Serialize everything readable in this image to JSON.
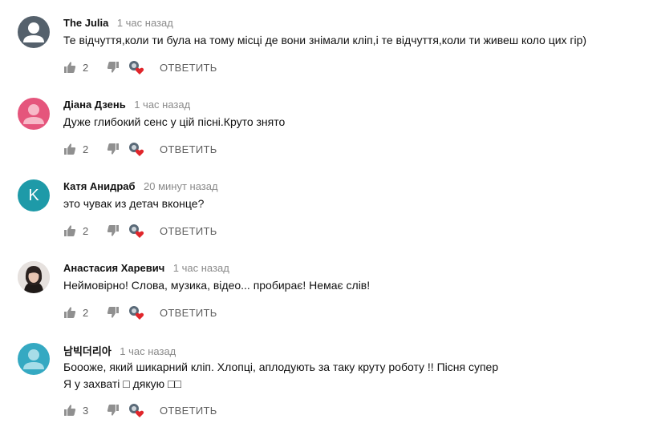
{
  "comments": [
    {
      "author": "The Julia",
      "time": "1 час назад",
      "text": [
        "Те відчуття,коли ти була на тому місці де  вони знімали кліп,і те відчуття,коли ти живеш коло цих гір)"
      ],
      "likes": "2",
      "reply": "ОТВЕТИТЬ",
      "avatar_color": "#55616c"
    },
    {
      "author": "Діана Дзень",
      "time": "1 час назад",
      "text": [
        "Дуже глибокий сенс у цій пісні.Круто знято"
      ],
      "likes": "2",
      "reply": "ОТВЕТИТЬ",
      "avatar_color": "#e5557c"
    },
    {
      "author": "Катя Анидраб",
      "time": "20 минут назад",
      "text": [
        "это чувак из детач вконце?"
      ],
      "likes": "2",
      "reply": "ОТВЕТИТЬ",
      "avatar_letter": "K",
      "avatar_color": "#1e9aa8"
    },
    {
      "author": "Анастасия Харевич",
      "time": "1 час назад",
      "text": [
        "Неймовірно! Слова, музика, відео... пробирає! Немає слів!"
      ],
      "likes": "2",
      "reply": "ОТВЕТИТЬ",
      "avatar_color": "#d8d2cf"
    },
    {
      "author": "남빅더리아",
      "time": "1 час назад",
      "text": [
        "Боооже, який шикарний кліп. Хлопці, аплодують за таку круту роботу !! Пісня супер",
        "Я у захваті □ дякую □□"
      ],
      "likes": "3",
      "reply": "ОТВЕТИТЬ",
      "avatar_color": "#35a9c2"
    }
  ]
}
